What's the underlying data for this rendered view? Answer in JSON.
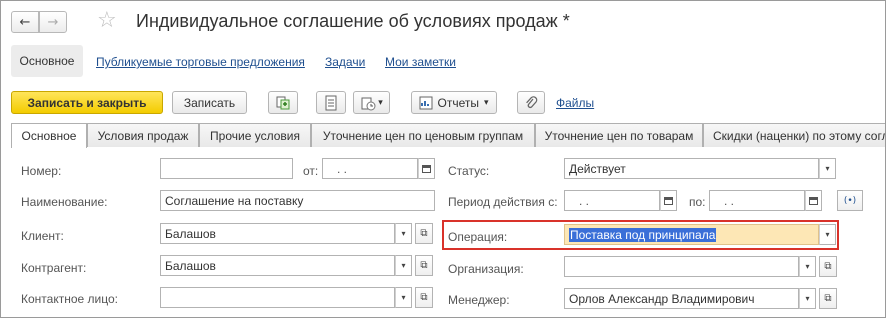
{
  "window": {
    "title": "Индивидуальное соглашение об условиях продаж *"
  },
  "nav": {
    "back_icon": "←",
    "forward_icon": "→",
    "star_icon": "☆"
  },
  "sections": {
    "active": "Основное",
    "links": [
      "Публикуемые торговые предложения",
      "Задачи",
      "Мои заметки"
    ]
  },
  "toolbar": {
    "save_close": "Записать и закрыть",
    "save": "Записать",
    "reports": "Отчеты",
    "files": "Файлы",
    "dropdown_glyph": "▾"
  },
  "tabs": [
    "Основное",
    "Условия продаж",
    "Прочие условия",
    "Уточнение цен по ценовым группам",
    "Уточнение цен по товарам",
    "Скидки (наценки) по этому согл"
  ],
  "form": {
    "number": {
      "label": "Номер:",
      "value": ""
    },
    "from": {
      "label": "от:",
      "value": ". ."
    },
    "name": {
      "label": "Наименование:",
      "value": "Соглашение на поставку"
    },
    "client": {
      "label": "Клиент:",
      "value": "Балашов"
    },
    "counterparty": {
      "label": "Контрагент:",
      "value": "Балашов"
    },
    "contact": {
      "label": "Контактное лицо:",
      "value": ""
    },
    "status": {
      "label": "Статус:",
      "value": "Действует"
    },
    "period": {
      "label": "Период действия с:",
      "from_value": ". .",
      "to_label": "по:",
      "to_value": ". ."
    },
    "operation": {
      "label": "Операция:",
      "value": "Поставка под принципала"
    },
    "organization": {
      "label": "Организация:",
      "value": ""
    },
    "manager": {
      "label": "Менеджер:",
      "value": "Орлов Александр Владимирович"
    }
  },
  "colors": {
    "accent_button": "#f3cc00",
    "highlight_border": "#d9322a",
    "selection": "#3a6fd8"
  }
}
